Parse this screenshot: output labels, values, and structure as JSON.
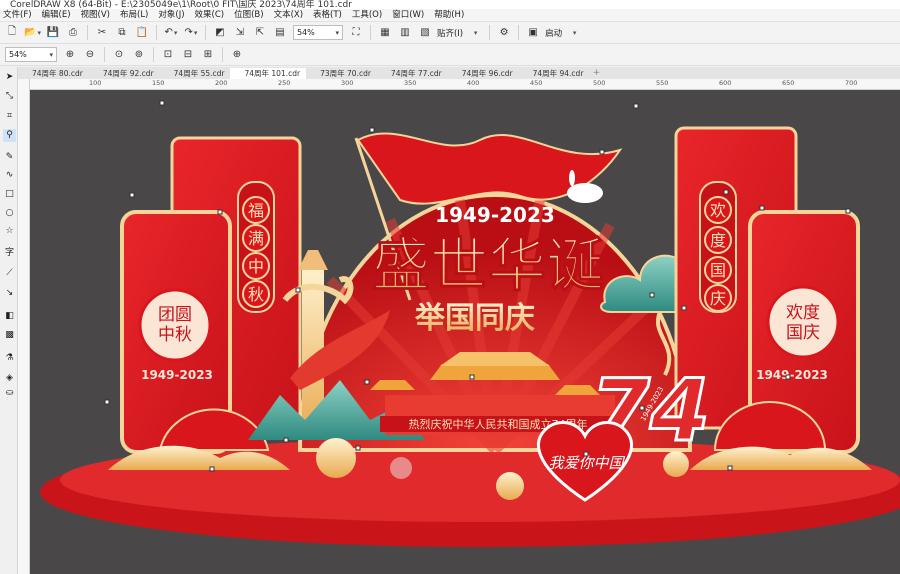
{
  "window": {
    "title": "CorelDRAW X8 (64-Bit) - E:\\2305049e\\1\\Root\\0 FIT\\国庆 2023\\74周年 101.cdr"
  },
  "menu": [
    "文件(F)",
    "编辑(E)",
    "视图(V)",
    "布局(L)",
    "对象(J)",
    "效果(C)",
    "位图(B)",
    "文本(X)",
    "表格(T)",
    "工具(O)",
    "窗口(W)",
    "帮助(H)"
  ],
  "toolbar": {
    "zoom_value": "54%",
    "snap_label": "贴齐(I)",
    "launch_label": "启动"
  },
  "propertybar": {
    "zoom_value": "54%"
  },
  "tabs": [
    "74周年 80.cdr",
    "74周年 92.cdr",
    "74周年 55.cdr",
    "74周年 101.cdr",
    "73周年 70.cdr",
    "74周年 77.cdr",
    "74周年 96.cdr",
    "74周年 94.cdr"
  ],
  "active_tab": "74周年 101.cdr",
  "ruler": {
    "h_ticks": [
      "100",
      "150",
      "200",
      "250",
      "300",
      "350",
      "400",
      "450",
      "500",
      "550",
      "600",
      "650",
      "700",
      "750"
    ]
  },
  "artwork": {
    "years": "1949-2023",
    "main_title": "盛世华诞",
    "subtitle": "举国同庆",
    "banner_text": "热烈庆祝中华人民共和国成立74周年",
    "number": "74",
    "number_years": "1949-2023",
    "left_panel_text": "团圆中秋",
    "left_panel_years": "1949-2023",
    "left_couplet": [
      "福",
      "满",
      "中",
      "秋"
    ],
    "right_couplet": [
      "欢",
      "度",
      "国",
      "庆"
    ],
    "right_panel_text": "欢度国庆",
    "right_panel_years": "1949-2023",
    "heart_text": "我爱你中国"
  },
  "colors": {
    "canvas_bg": "#4a4749",
    "red": "#d8161b",
    "gold": "#f5c98a",
    "teal": "#4aa39a"
  }
}
